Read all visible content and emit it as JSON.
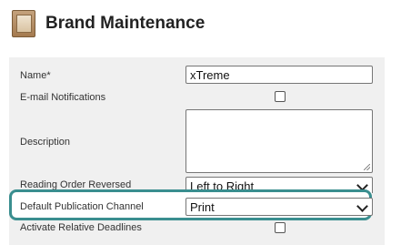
{
  "header": {
    "title": "Brand Maintenance",
    "icon": "brand-book-icon"
  },
  "form": {
    "name_label": "Name*",
    "name_value": "xTreme",
    "email_label": "E-mail Notifications",
    "description_label": "Description",
    "description_value": "",
    "reading_order_label": "Reading Order Reversed",
    "reading_order_value": "Left to Right",
    "publication_channel_label": "Default Publication Channel",
    "publication_channel_value": "Print",
    "relative_deadlines_label": "Activate Relative Deadlines"
  },
  "colors": {
    "highlight": "#3a8e8f",
    "panel_bg": "#f0f0f0"
  }
}
